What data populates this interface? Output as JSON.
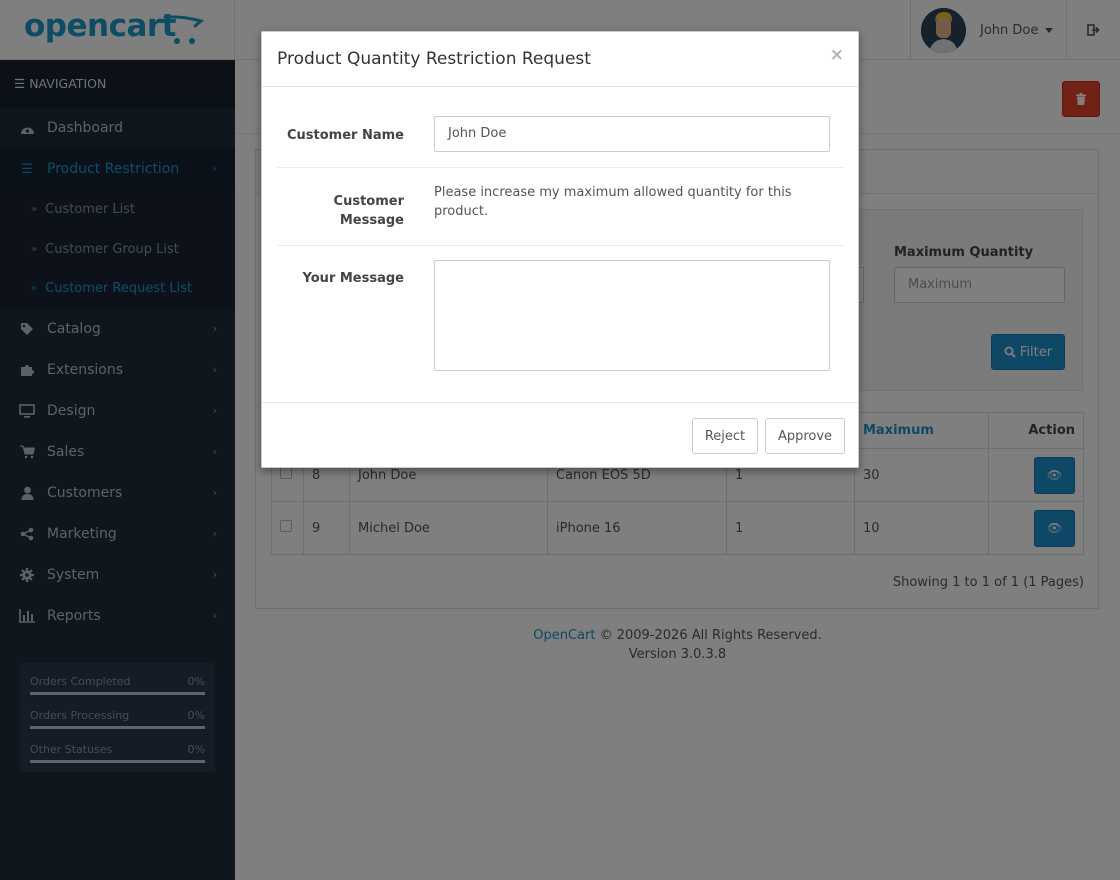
{
  "header": {
    "logo_text": "opencart",
    "user_name": "John Doe",
    "logout_icon": "sign-out-icon"
  },
  "sidebar": {
    "heading": "Navigation",
    "items": [
      {
        "label": "Dashboard",
        "icon": "dashboard-icon"
      },
      {
        "label": "Product Restriction",
        "icon": "bars-icon",
        "active": true,
        "children": [
          {
            "label": "Customer List"
          },
          {
            "label": "Customer Group List"
          },
          {
            "label": "Customer Request List",
            "active": true
          }
        ]
      },
      {
        "label": "Catalog",
        "icon": "tags-icon"
      },
      {
        "label": "Extensions",
        "icon": "puzzle-icon"
      },
      {
        "label": "Design",
        "icon": "desktop-icon"
      },
      {
        "label": "Sales",
        "icon": "cart-icon"
      },
      {
        "label": "Customers",
        "icon": "user-icon"
      },
      {
        "label": "Marketing",
        "icon": "share-icon"
      },
      {
        "label": "System",
        "icon": "gear-icon"
      },
      {
        "label": "Reports",
        "icon": "bar-chart-icon"
      }
    ],
    "stats": [
      {
        "label": "Orders Completed",
        "percent": "0%"
      },
      {
        "label": "Orders Processing",
        "percent": "0%"
      },
      {
        "label": "Other Statuses",
        "percent": "0%"
      }
    ]
  },
  "filter": {
    "max_quantity_label": "Maximum Quantity",
    "max_quantity_placeholder": "Maximum",
    "filter_button": "Filter"
  },
  "table": {
    "headers": {
      "maximum": "Maximum",
      "action": "Action"
    },
    "rows": [
      {
        "id": "8",
        "customer": "John Doe",
        "product": "Canon EOS 5D",
        "minimum": "1",
        "maximum": "30"
      },
      {
        "id": "9",
        "customer": "Michel Doe",
        "product": "iPhone 16",
        "minimum": "1",
        "maximum": "10"
      }
    ],
    "pagination": "Showing 1 to 1 of 1 (1 Pages)"
  },
  "footer": {
    "link": "OpenCart",
    "copyright": "© 2009-2026 All Rights Reserved.",
    "version": "Version 3.0.3.8"
  },
  "modal": {
    "title": "Product Quantity Restriction Request",
    "close": "×",
    "customer_name_label": "Customer Name",
    "customer_name_value": "John Doe",
    "customer_message_label_1": "Customer",
    "customer_message_label_2": "Message",
    "customer_message_value": "Please increase my maximum allowed quantity for this product.",
    "your_message_label": "Your Message",
    "your_message_value": "",
    "reject_button": "Reject",
    "approve_button": "Approve"
  },
  "colors": {
    "brand_blue": "#1e91cf",
    "sidebar_bg": "#1f2c3c",
    "danger": "#e2422a"
  }
}
